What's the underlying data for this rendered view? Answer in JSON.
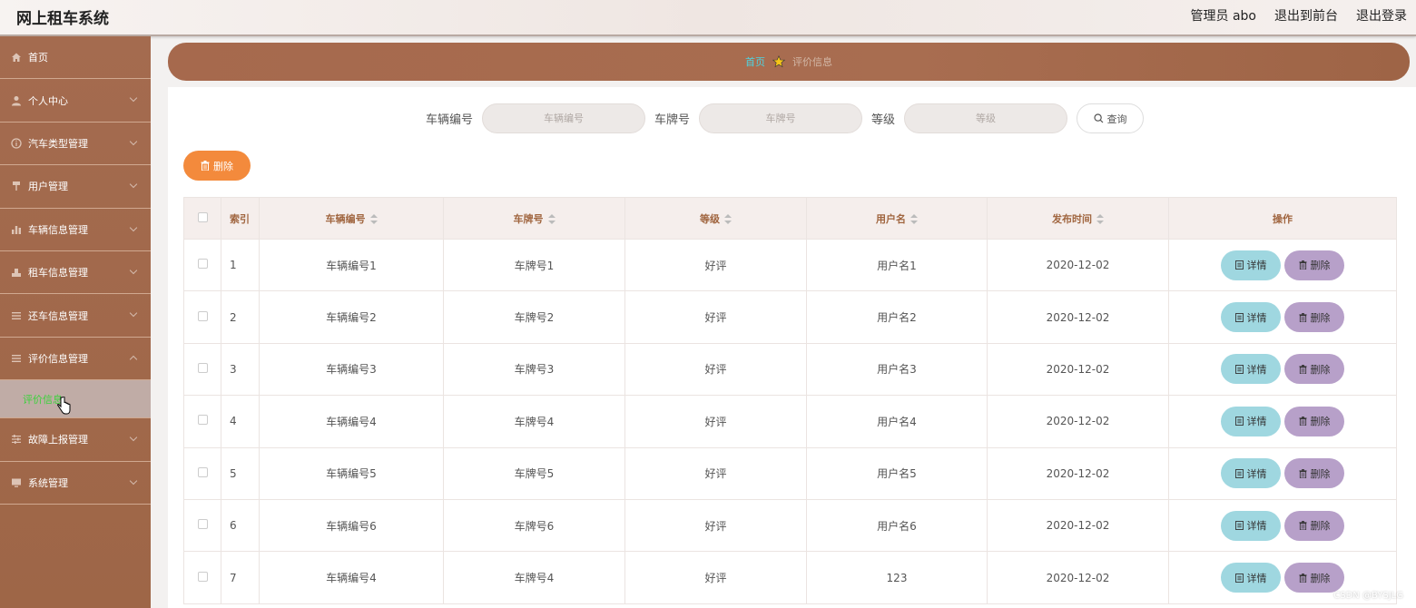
{
  "header": {
    "app_title": "网上租车系统",
    "admin_label": "管理员 abo",
    "frontend_link": "退出到前台",
    "logout_link": "退出登录"
  },
  "sidebar": {
    "items": [
      {
        "label": "首页",
        "icon": "home-icon",
        "chevron": false
      },
      {
        "label": "个人中心",
        "icon": "user-icon",
        "chevron": true
      },
      {
        "label": "汽车类型管理",
        "icon": "info-icon",
        "chevron": true
      },
      {
        "label": "用户管理",
        "icon": "pin-icon",
        "chevron": true
      },
      {
        "label": "车辆信息管理",
        "icon": "chart-icon",
        "chevron": true
      },
      {
        "label": "租车信息管理",
        "icon": "stamp-icon",
        "chevron": true
      },
      {
        "label": "还车信息管理",
        "icon": "list-icon",
        "chevron": true
      },
      {
        "label": "评价信息管理",
        "icon": "list-icon",
        "chevron": true,
        "expanded": true
      }
    ],
    "sub_item": "评价信息",
    "items_after": [
      {
        "label": "故障上报管理",
        "icon": "sliders-icon",
        "chevron": true
      },
      {
        "label": "系统管理",
        "icon": "monitor-icon",
        "chevron": true
      }
    ]
  },
  "breadcrumb": {
    "home": "首页",
    "current": "评价信息"
  },
  "search": {
    "vehicle_no_label": "车辆编号",
    "vehicle_no_placeholder": "车辆编号",
    "plate_label": "车牌号",
    "plate_placeholder": "车牌号",
    "level_label": "等级",
    "level_placeholder": "等级",
    "query_button": "查询"
  },
  "toolbar": {
    "delete_label": "删除"
  },
  "table": {
    "headers": [
      "索引",
      "车辆编号",
      "车牌号",
      "等级",
      "用户名",
      "发布时间",
      "操作"
    ],
    "rows": [
      {
        "index": "1",
        "vehicle_no": "车辆编号1",
        "plate": "车牌号1",
        "level": "好评",
        "username": "用户名1",
        "time": "2020-12-02"
      },
      {
        "index": "2",
        "vehicle_no": "车辆编号2",
        "plate": "车牌号2",
        "level": "好评",
        "username": "用户名2",
        "time": "2020-12-02"
      },
      {
        "index": "3",
        "vehicle_no": "车辆编号3",
        "plate": "车牌号3",
        "level": "好评",
        "username": "用户名3",
        "time": "2020-12-02"
      },
      {
        "index": "4",
        "vehicle_no": "车辆编号4",
        "plate": "车牌号4",
        "level": "好评",
        "username": "用户名4",
        "time": "2020-12-02"
      },
      {
        "index": "5",
        "vehicle_no": "车辆编号5",
        "plate": "车牌号5",
        "level": "好评",
        "username": "用户名5",
        "time": "2020-12-02"
      },
      {
        "index": "6",
        "vehicle_no": "车辆编号6",
        "plate": "车牌号6",
        "level": "好评",
        "username": "用户名6",
        "time": "2020-12-02"
      },
      {
        "index": "7",
        "vehicle_no": "车辆编号4",
        "plate": "车牌号4",
        "level": "好评",
        "username": "123",
        "time": "2020-12-02"
      }
    ],
    "detail_label": "详情",
    "delete_label": "删除"
  },
  "watermark": "CSDN @BYSJLG",
  "colors": {
    "sidebar": "#a46b4f",
    "header_th": "#a0653f",
    "delete_orange": "#f38a3c",
    "detail_teal": "#9fd7e0",
    "delete_purple": "#b7a0c9",
    "breadcrumb_home": "#4fd3e0",
    "active_sub": "#3bd23b"
  }
}
